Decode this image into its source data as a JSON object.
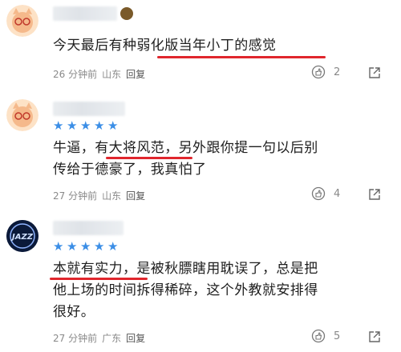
{
  "comments": [
    {
      "text": "今天最后有种弱化版当年小丁的感觉",
      "time": "26 分钟前",
      "location": "山东",
      "reply": "回复",
      "likes": "2"
    },
    {
      "text": "牛逼，有大将风范，另外跟你提一句以后别\n传给于德豪了，我真怕了",
      "time": "27 分钟前",
      "location": "山东",
      "reply": "回复",
      "likes": "4"
    },
    {
      "text": "本就有实力，是被秋膘瞎用耽误了，总是把\n他上场的时间拆得稀碎，这个外教就安排得\n很好。",
      "time": "27 分钟前",
      "location": "广东",
      "reply": "回复",
      "likes": "5"
    }
  ],
  "colors": {
    "star": "#3b8ee6",
    "underline": "#e0262d"
  },
  "icons": {
    "like": "thumbs-up-circle-icon",
    "share": "share-arrow-icon",
    "star": "star-icon"
  }
}
